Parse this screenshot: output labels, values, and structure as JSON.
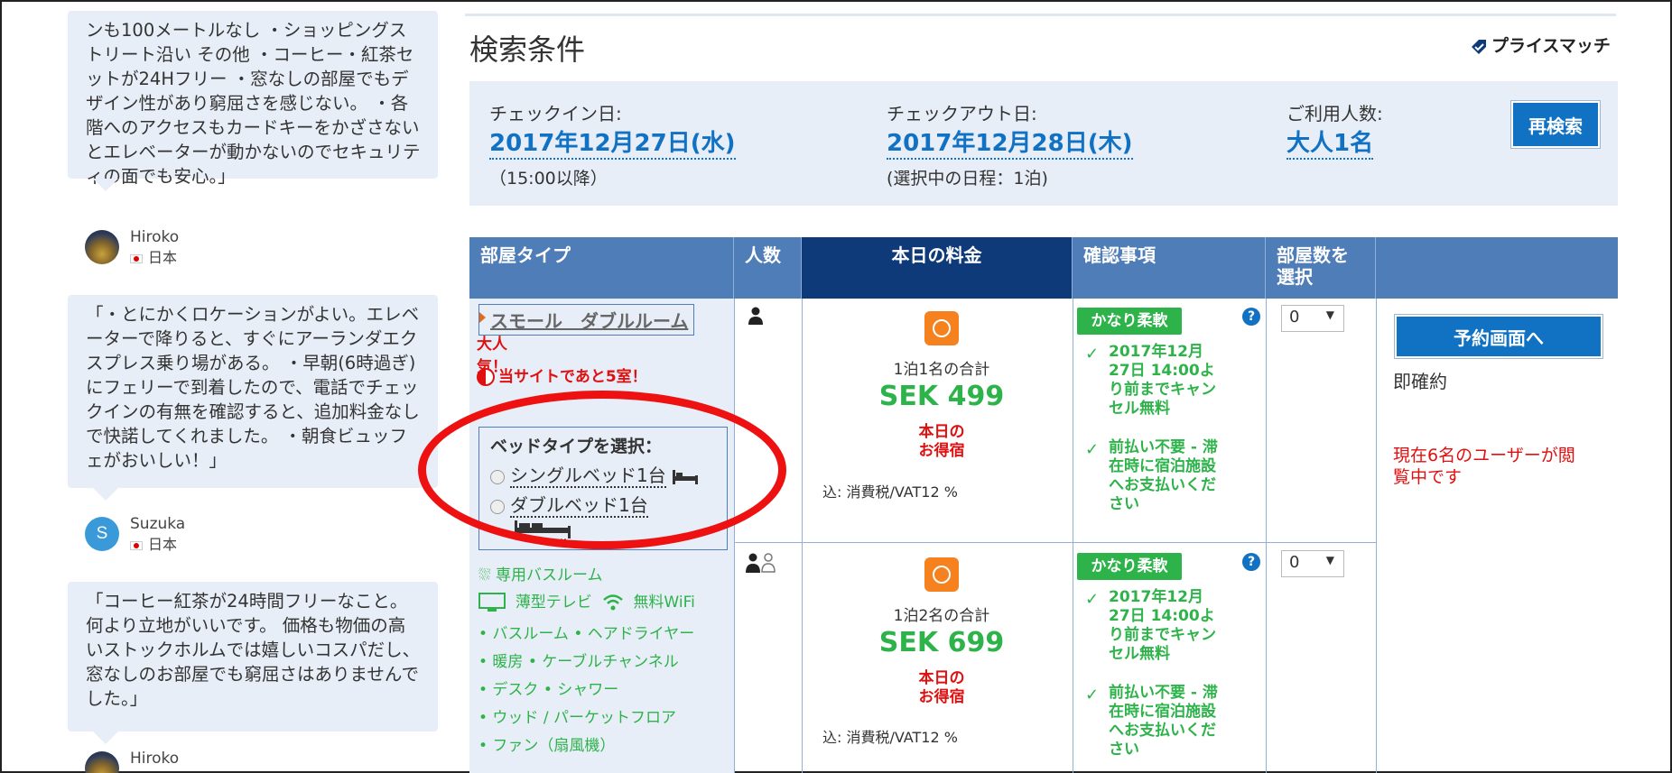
{
  "reviews": [
    {
      "text": "ンも100メートルなし ・ショッピングストリート沿い その他 ・コーヒー・紅茶セットが24Hフリー ・窓なしの部屋でもデザイン性があり窮屈さを感じない。 ・各階へのアクセスもカードキーをかざさないとエレベーターが動かないのでセキュリティの面でも安心。」",
      "name": "Hiroko",
      "country": "日本"
    },
    {
      "text": "「・とにかくロケーションがよい。エレベーターで降りると、すぐにアーランダエクスプレス乗り場がある。 ・早朝(6時過ぎ)にフェリーで到着したので、電話でチェックインの有無を確認すると、追加料金なしで快諾してくれました。 ・朝食ビュッフェがおいしい！」",
      "name": "Suzuka",
      "avatar_letter": "S",
      "country": "日本"
    },
    {
      "text": "「コーヒー紅茶が24時間フリーなこと。何より立地がいいです。 価格も物価の高いストックホルムでは嬉しいコスパだし、窓なしのお部屋でも窮屈さはありませんでした。」",
      "name": "Hiroko"
    }
  ],
  "search": {
    "title": "検索条件",
    "price_match": "プライスマッチ",
    "checkin_label": "チェックイン日:",
    "checkin_value": "2017年12月27日(水)",
    "checkin_sub": "（15:00以降）",
    "checkout_label": "チェックアウト日:",
    "checkout_value": "2017年12月28日(木)",
    "checkout_sub": "(選択中の日程：1泊)",
    "guests_label": "ご利用人数:",
    "guests_value": "大人1名",
    "research_button": "再検索"
  },
  "table": {
    "headers": {
      "room_type": "部屋タイプ",
      "guests": "人数",
      "price": "本日の料金",
      "conditions": "確認事項",
      "rooms": "部屋数を選択"
    },
    "room": {
      "name": "スモール　ダブルルーム",
      "popular": "大人気！",
      "remaining": "当サイトであと5室！",
      "bed_select_title": "ベッドタイプを選択：",
      "bed_options": [
        "シングルベッド1台",
        "ダブルベッド1台"
      ],
      "amenities": {
        "bathroom": "専用バスルーム",
        "tv": "薄型テレビ",
        "wifi": "無料WiFi",
        "line1": "• バスルーム  • ヘアドライヤー",
        "line2": "• 暖房  • ケーブルチャンネル",
        "line3": "• デスク  • シャワー",
        "line4": "• ウッド / パーケットフロア",
        "line5": "• ファン（扇風機）"
      }
    },
    "rows": [
      {
        "per_label": "1泊1名の合計",
        "price": "SEK 499",
        "deal": "本日の\nお得宿",
        "tax": "込: 消費税/VAT12 %",
        "badge": "かなり柔軟",
        "cancel": "2017年12月27日 14:00より前までキャンセル無料",
        "prepay": "前払い不要 - 滞在時に宿泊施設へお支払いください",
        "qty": "0"
      },
      {
        "per_label": "1泊2名の合計",
        "price": "SEK 699",
        "deal": "本日の\nお得宿",
        "tax": "込: 消費税/VAT12 %",
        "badge": "かなり柔軟",
        "cancel": "2017年12月27日 14:00より前までキャンセル無料",
        "prepay": "前払い不要 - 滞在時に宿泊施設へお支払いください",
        "qty": "0"
      }
    ],
    "book_button": "予約画面へ",
    "instant": "即確約",
    "viewers": "現在6名のユーザーが閲覧中です"
  },
  "colors": {
    "accent_blue": "#1172c4",
    "header_blue": "#4f7db8",
    "header_dark": "#0e3a7a",
    "green": "#2db34a",
    "red": "#e01010",
    "highlight_circle": "#ee1111"
  },
  "icons": [
    "price-tag-icon",
    "person-icon",
    "persons-icon",
    "deal-icon",
    "help-icon",
    "check-icon",
    "shower-icon",
    "tv-icon",
    "wifi-icon",
    "bed-icon"
  ]
}
